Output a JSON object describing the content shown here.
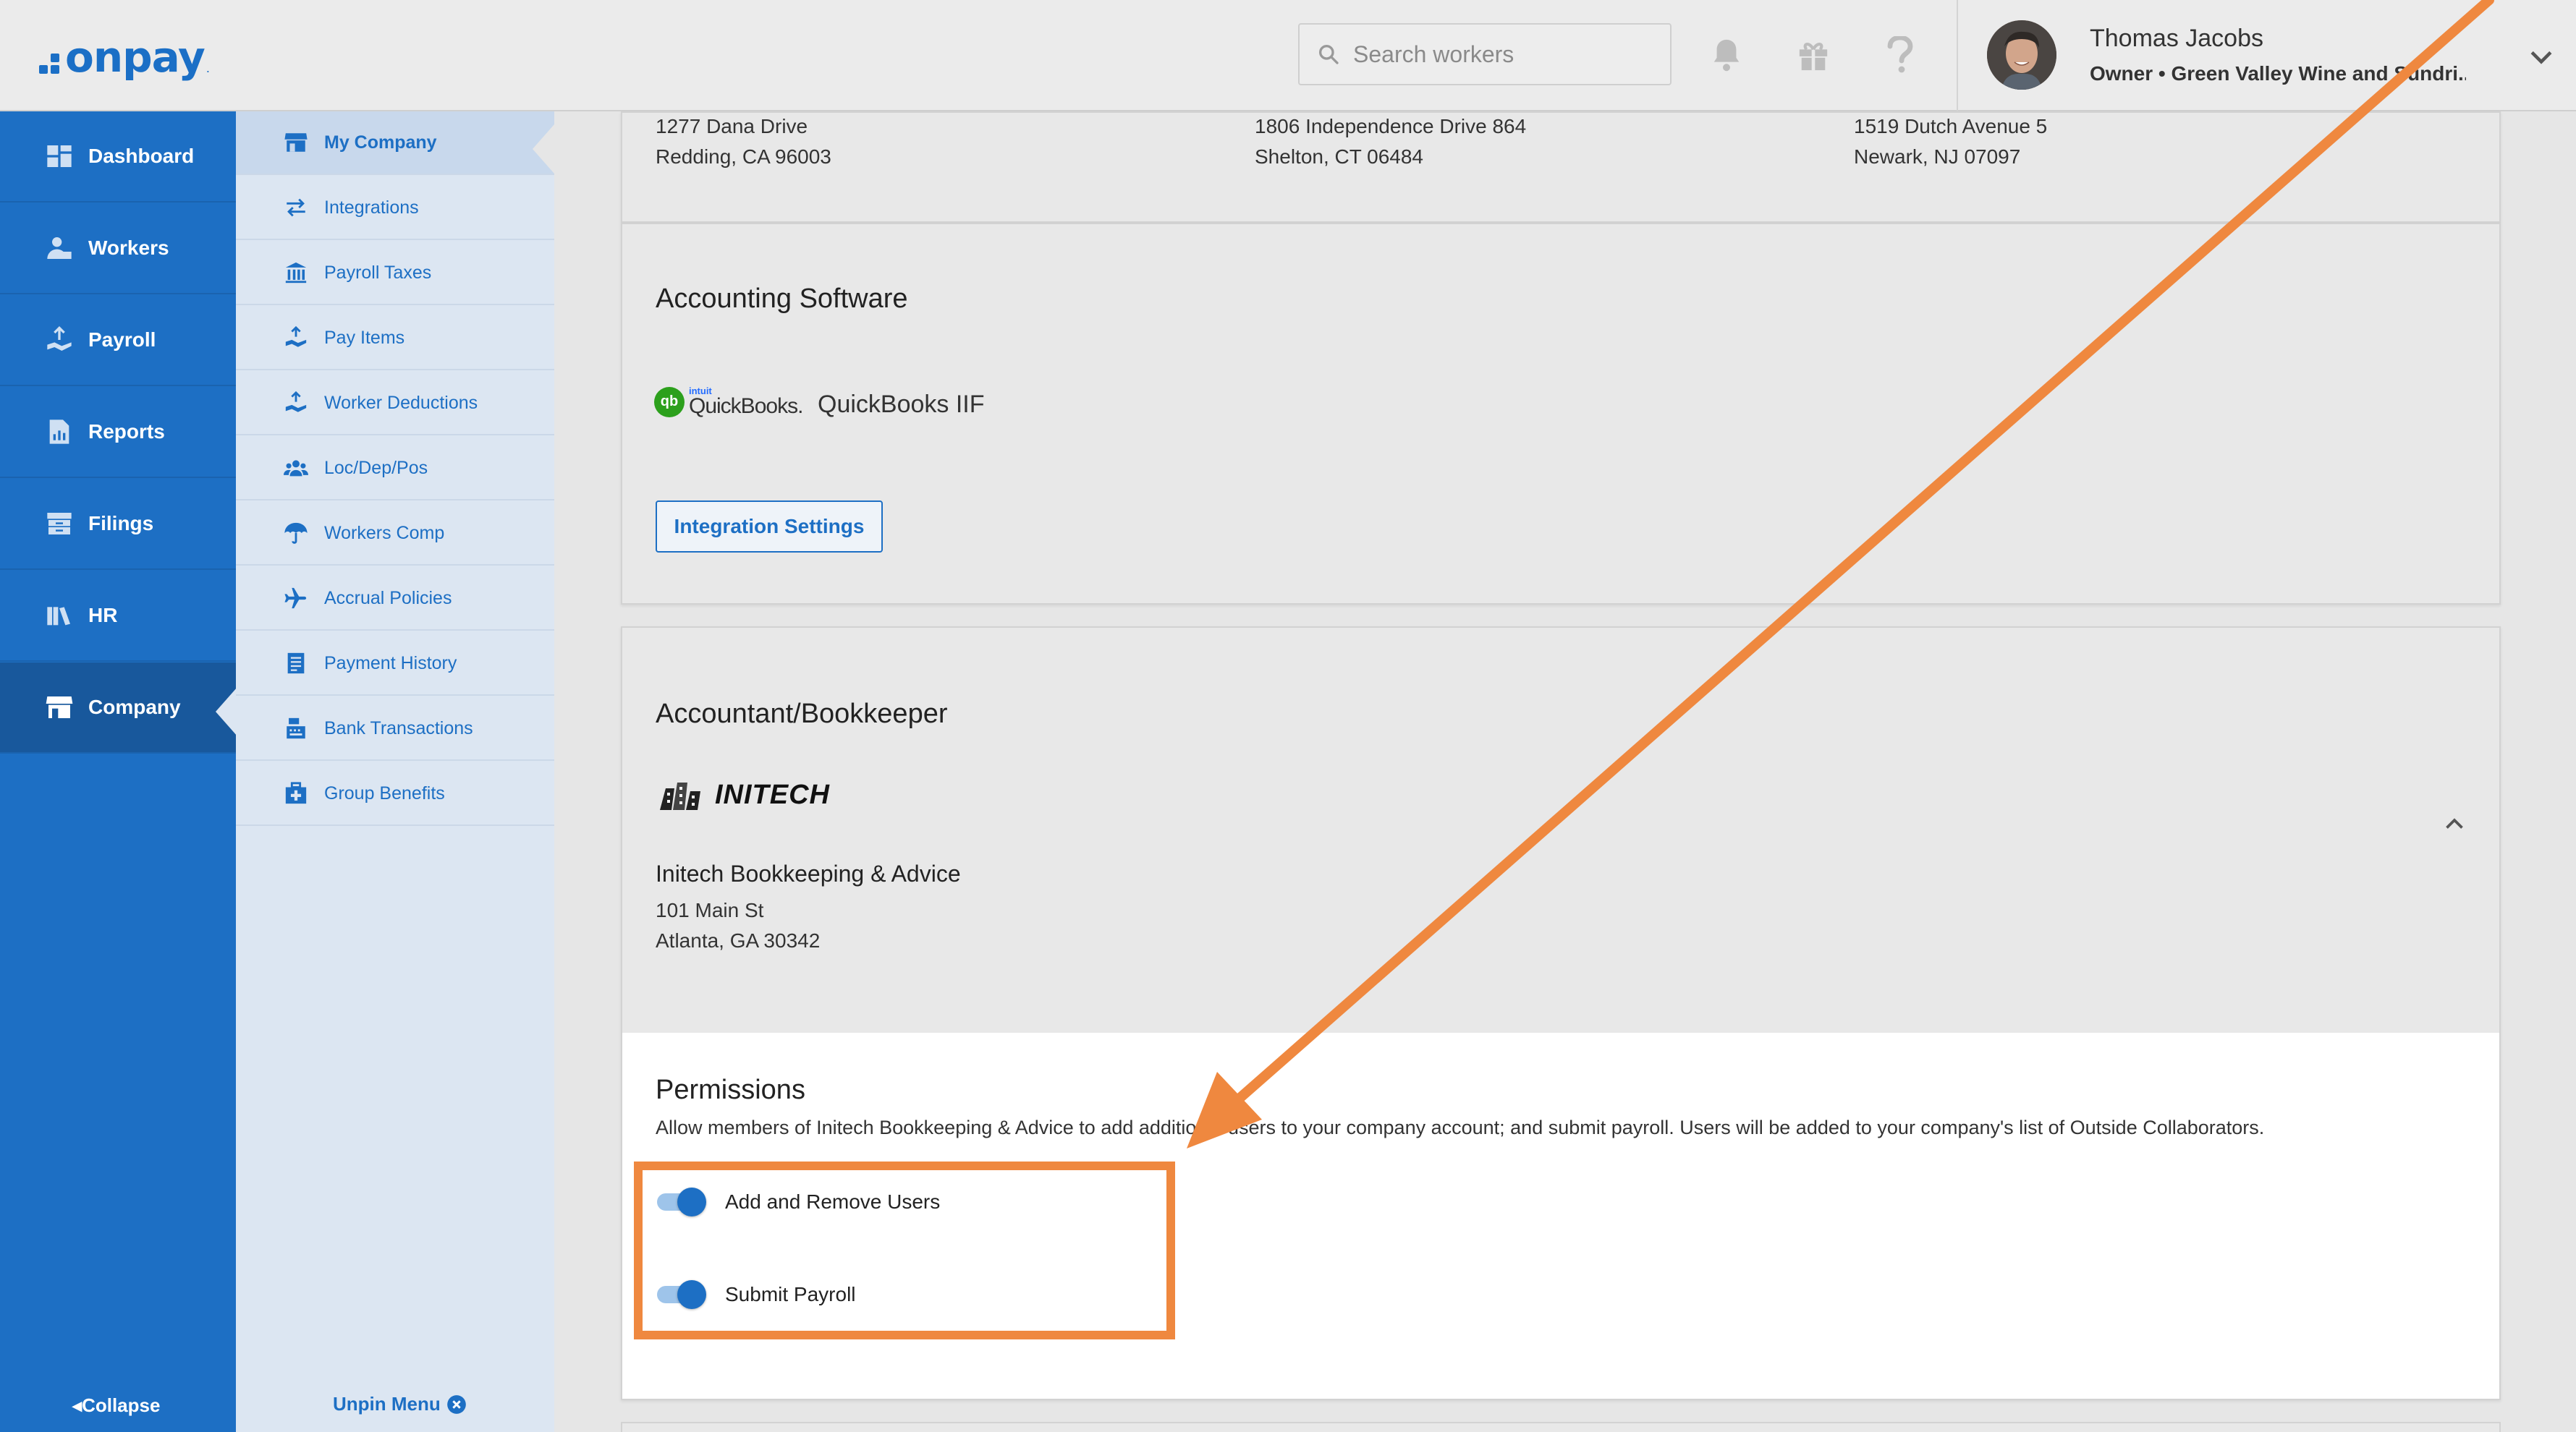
{
  "app": {
    "logo_text": "onpay",
    "logo_mark": "."
  },
  "header": {
    "search_placeholder": "Search workers",
    "user_name": "Thomas Jacobs",
    "user_role": "Owner • Green Valley Wine and Sundri..."
  },
  "nav": {
    "items": [
      {
        "label": "Dashboard",
        "icon": "dashboard-icon"
      },
      {
        "label": "Workers",
        "icon": "workers-icon"
      },
      {
        "label": "Payroll",
        "icon": "payroll-icon"
      },
      {
        "label": "Reports",
        "icon": "reports-icon"
      },
      {
        "label": "Filings",
        "icon": "filings-icon"
      },
      {
        "label": "HR",
        "icon": "hr-icon"
      },
      {
        "label": "Company",
        "icon": "company-icon",
        "active": true
      }
    ],
    "collapse_label": "Collapse"
  },
  "subnav": {
    "items": [
      {
        "label": "My Company",
        "active": true
      },
      {
        "label": "Integrations"
      },
      {
        "label": "Payroll Taxes"
      },
      {
        "label": "Pay Items"
      },
      {
        "label": "Worker Deductions"
      },
      {
        "label": "Loc/Dep/Pos"
      },
      {
        "label": "Workers Comp"
      },
      {
        "label": "Accrual Policies"
      },
      {
        "label": "Payment History"
      },
      {
        "label": "Bank Transactions"
      },
      {
        "label": "Group Benefits"
      }
    ],
    "unpin_label": "Unpin Menu"
  },
  "addresses": [
    {
      "line1": "1277 Dana Drive",
      "line2": "Redding, CA 96003"
    },
    {
      "line1": "1806 Independence Drive 864",
      "line2": "Shelton, CT 06484"
    },
    {
      "line1": "1519 Dutch Avenue 5",
      "line2": "Newark, NJ 07097"
    }
  ],
  "accounting": {
    "title": "Accounting Software",
    "logo_intuit": "intuit",
    "logo_name": "QuickBooks.",
    "logo_circle": "qb",
    "software_name": "QuickBooks IIF",
    "button_label": "Integration Settings"
  },
  "accountant": {
    "title": "Accountant/Bookkeeper",
    "logo_text": "INITECH",
    "name": "Initech Bookkeeping & Advice",
    "address_line1": "101 Main St",
    "address_line2": "Atlanta, GA 30342"
  },
  "permissions": {
    "title": "Permissions",
    "description": "Allow members of Initech Bookkeeping & Advice to add additional users to your company account; and submit payroll. Users will be added to your company's list of Outside Collaborators.",
    "toggles": [
      {
        "label": "Add and Remove Users",
        "on": true
      },
      {
        "label": "Submit Payroll",
        "on": true
      }
    ]
  },
  "colors": {
    "brand": "#1d6fc4",
    "annotation": "#ef883f"
  }
}
